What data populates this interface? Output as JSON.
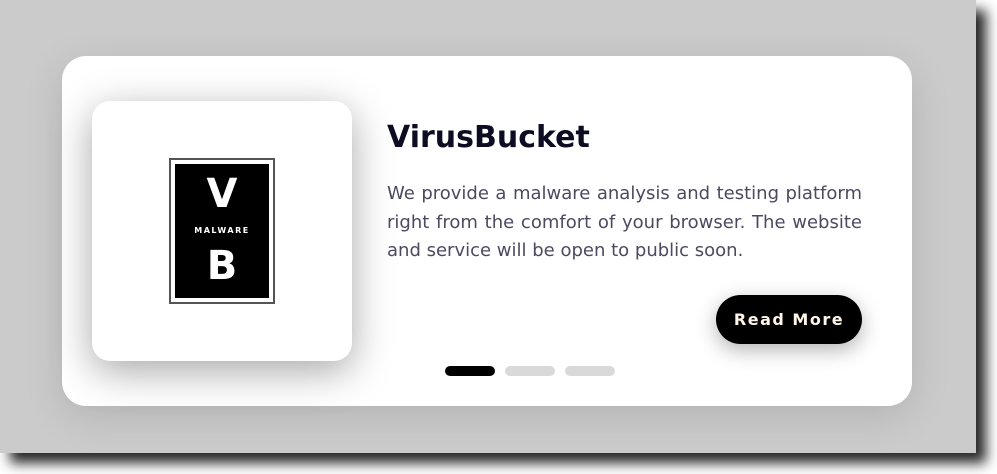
{
  "card": {
    "title": "VirusBucket",
    "description": "We provide a malware analysis and testing platform right from the comfort of your browser. The website and service will be open to public soon.",
    "read_more_label": "Read More"
  },
  "logo": {
    "top_letter": "V",
    "word": "MALWARE",
    "bottom_letter": "B"
  },
  "pagination": {
    "total": 3,
    "active_index": 0
  },
  "colors": {
    "backdrop": "#cbcbcb",
    "card": "#ffffff",
    "button": "#000000",
    "button_text": "#fff5e8",
    "active_dot": "#000000",
    "inactive_dot": "#d9d9d9",
    "title": "#0d0c22",
    "description": "#4b4a60"
  }
}
